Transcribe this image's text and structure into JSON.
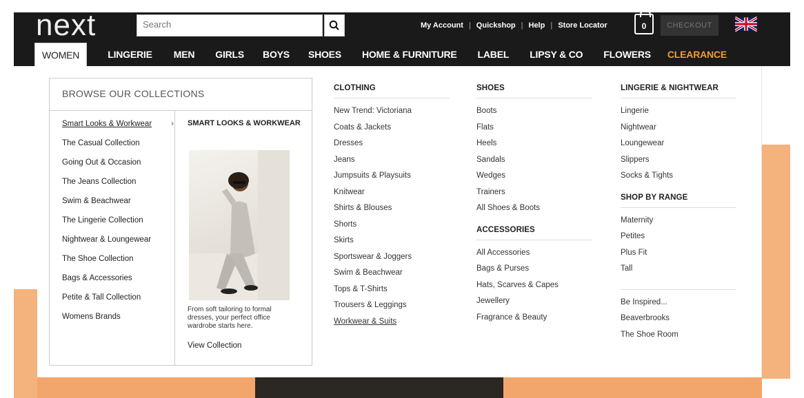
{
  "header": {
    "logo": "next",
    "search_placeholder": "Search",
    "top_links": [
      "My Account",
      "Quickshop",
      "Help",
      "Store Locator"
    ],
    "bag_count": "0",
    "checkout_label": "CHECKOUT"
  },
  "nav": {
    "items": [
      "WOMEN",
      "LINGERIE",
      "MEN",
      "GIRLS",
      "BOYS",
      "SHOES",
      "HOME & FURNITURE",
      "LABEL",
      "LIPSY & CO",
      "FLOWERS",
      "CLEARANCE"
    ],
    "active": "WOMEN"
  },
  "collections": {
    "title": "BROWSE OUR COLLECTIONS",
    "items": [
      "Smart Looks & Workwear",
      "The Casual Collection",
      "Going Out & Occasion",
      "The Jeans Collection",
      "Swim & Beachwear",
      "The Lingerie Collection",
      "Nightwear & Loungewear",
      "The Shoe Collection",
      "Bags & Accessories",
      "Petite & Tall Collection",
      "Womens Brands"
    ],
    "feature_title": "SMART LOOKS & WORKWEAR",
    "feature_desc": "From soft tailoring to formal dresses, your perfect office wardrobe starts here.",
    "feature_link": "View Collection"
  },
  "clothing": {
    "heading": "CLOTHING",
    "items": [
      "New Trend: Victoriana",
      "Coats & Jackets",
      "Dresses",
      "Jeans",
      "Jumpsuits & Playsuits",
      "Knitwear",
      "Shirts & Blouses",
      "Shorts",
      "Skirts",
      "Sportswear & Joggers",
      "Swim & Beachwear",
      "Tops & T-Shirts",
      "Trousers & Leggings",
      "Workwear & Suits"
    ]
  },
  "shoes": {
    "heading": "SHOES",
    "items": [
      "Boots",
      "Flats",
      "Heels",
      "Sandals",
      "Wedges",
      "Trainers",
      "All Shoes & Boots"
    ]
  },
  "accessories": {
    "heading": "ACCESSORIES",
    "items": [
      "All Accessories",
      "Bags & Purses",
      "Hats, Scarves & Capes",
      "Jewellery",
      "Fragrance & Beauty"
    ]
  },
  "lingerie": {
    "heading": "LINGERIE & NIGHTWEAR",
    "items": [
      "Lingerie",
      "Nightwear",
      "Loungewear",
      "Slippers",
      "Socks & Tights"
    ]
  },
  "range": {
    "heading": "SHOP BY RANGE",
    "items": [
      "Maternity",
      "Petites",
      "Plus Fit",
      "Tall"
    ]
  },
  "extras": {
    "items": [
      "Be Inspired...",
      "Beaverbrooks",
      "The Shoe Room"
    ]
  },
  "colors": {
    "header_bg": "#1a1a1a",
    "clearance": "#f39c32",
    "peach_bg": "#f4b27c"
  }
}
